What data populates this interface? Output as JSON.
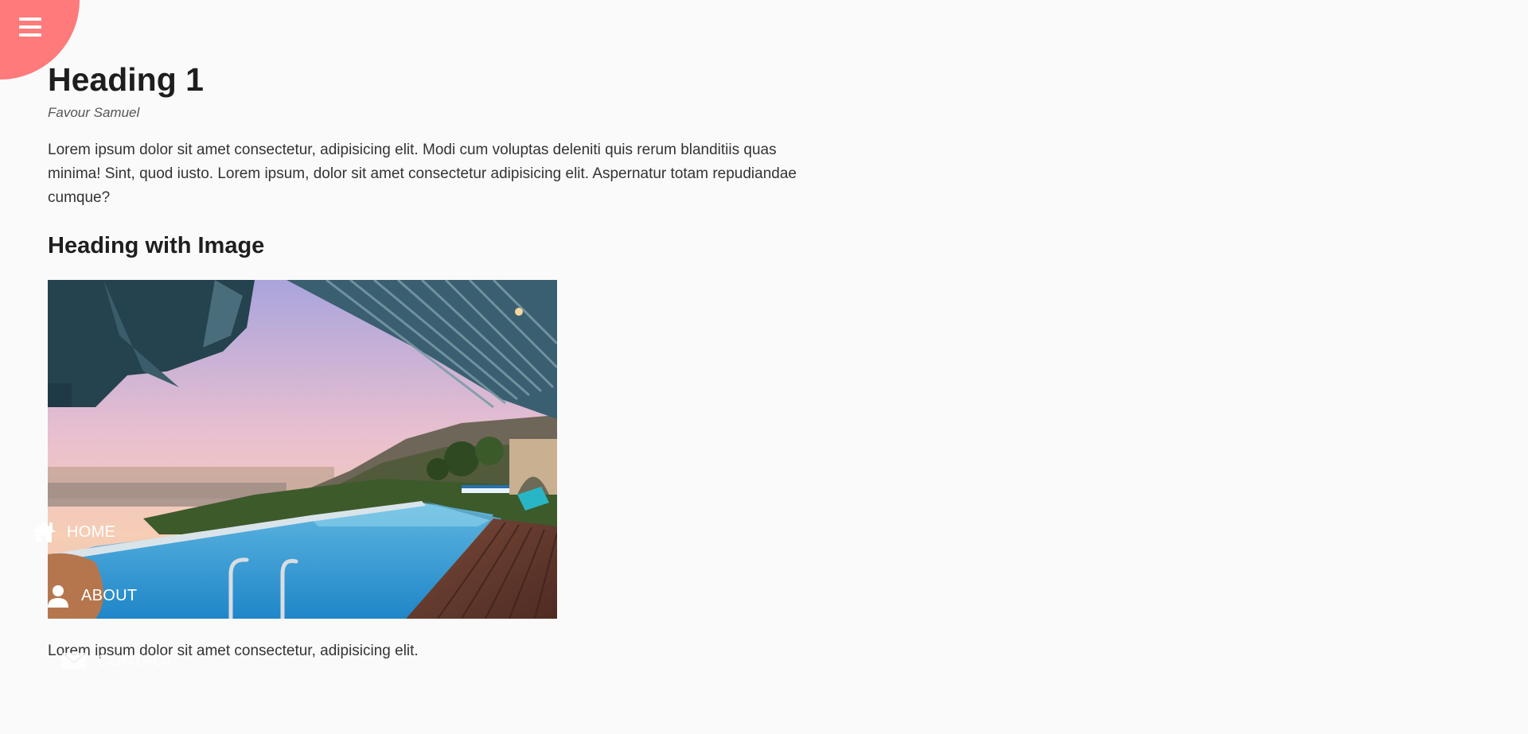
{
  "menu": {
    "icon": "hamburger-icon",
    "accent_color": "#ff7a7a"
  },
  "article": {
    "title": "Heading 1",
    "author": "Favour Samuel",
    "paragraph1": "Lorem ipsum dolor sit amet consectetur, adipisicing elit. Modi cum voluptas deleniti quis rerum blanditiis quas minima! Sint, quod iusto. Lorem ipsum, dolor sit amet consectetur adipisicing elit. Aspernatur totam repudiandae cumque?",
    "subheading": "Heading with Image",
    "image_alt": "Infinity pool overlooking a city at sunset",
    "paragraph2": "Lorem ipsum dolor sit amet consectetur, adipisicing elit."
  },
  "nav": {
    "items": [
      {
        "label": "HOME",
        "icon": "home-icon"
      },
      {
        "label": "ABOUT",
        "icon": "user-icon"
      },
      {
        "label": "CONTACT",
        "icon": "envelope-icon"
      }
    ]
  }
}
